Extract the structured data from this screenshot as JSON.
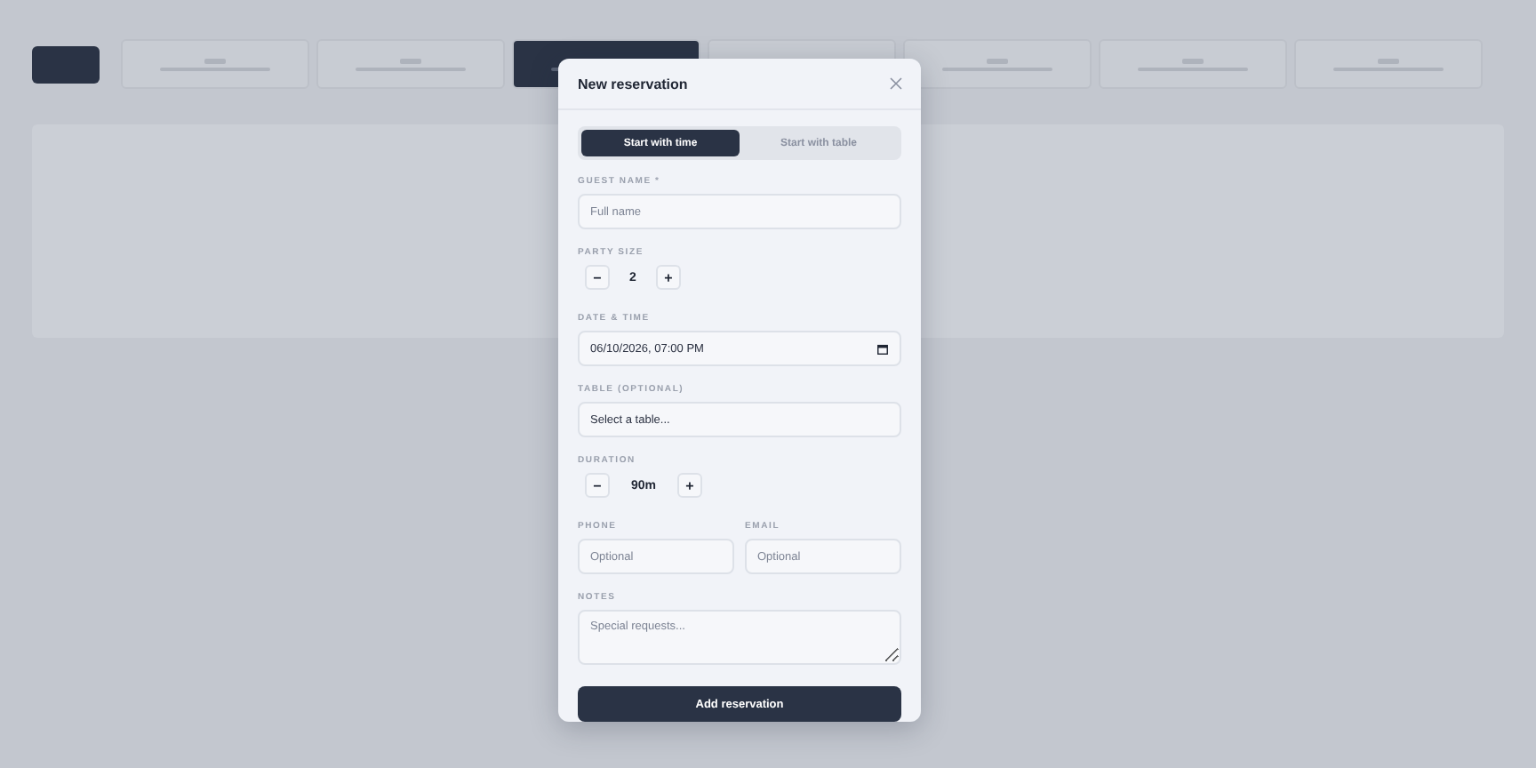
{
  "background": {
    "days": [
      {
        "selected": false
      },
      {
        "selected": false
      },
      {
        "selected": true
      },
      {
        "selected": false
      },
      {
        "selected": false
      },
      {
        "selected": false
      },
      {
        "selected": false
      }
    ]
  },
  "dialog": {
    "title": "New reservation",
    "modes": [
      {
        "label": "Start with time",
        "selected": true
      },
      {
        "label": "Start with table",
        "selected": false
      }
    ],
    "guest_name": {
      "label": "GUEST NAME *",
      "placeholder": "Full name"
    },
    "party_size": {
      "label": "PARTY SIZE",
      "value": "2",
      "minus": "−",
      "plus": "+"
    },
    "date_time": {
      "label": "DATE & TIME",
      "value": "06/10/2026, 07:00 PM"
    },
    "table": {
      "label": "TABLE (OPTIONAL)",
      "value": "Select a table..."
    },
    "duration": {
      "label": "DURATION",
      "value": "90m",
      "minus": "−",
      "plus": "+"
    },
    "phone": {
      "label": "PHONE",
      "placeholder": "Optional"
    },
    "email": {
      "label": "EMAIL",
      "placeholder": "Optional"
    },
    "notes": {
      "label": "NOTES",
      "placeholder": "Special requests..."
    },
    "submit": "Add reservation"
  }
}
